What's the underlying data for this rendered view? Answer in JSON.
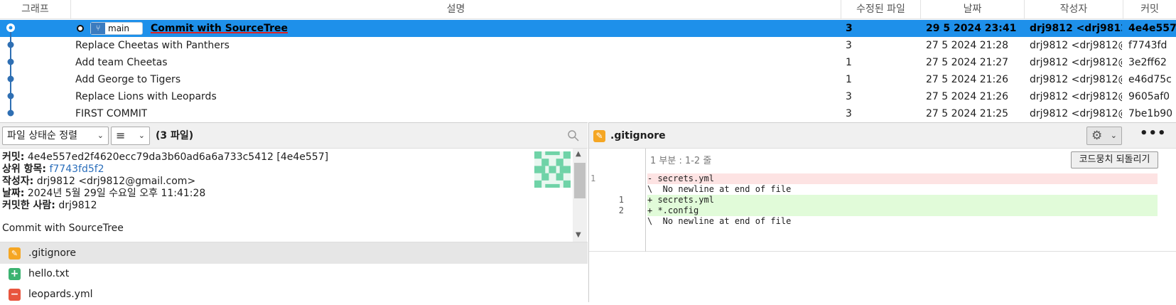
{
  "log": {
    "headers": {
      "graph": "그래프",
      "description": "설명",
      "changed_files": "수정된 파일",
      "date": "날짜",
      "author": "작성자",
      "commit": "커밋"
    },
    "branch_label": "main",
    "commits": [
      {
        "message": "Commit with SourceTree",
        "files": "3",
        "date": "29 5 2024 23:41",
        "author": "drj9812 <drj9812",
        "hash": "4e4e557"
      },
      {
        "message": "Replace Cheetas with Panthers",
        "files": "3",
        "date": "27 5 2024 21:28",
        "author": "drj9812 <drj9812@",
        "hash": "f7743fd"
      },
      {
        "message": "Add team Cheetas",
        "files": "1",
        "date": "27 5 2024 21:27",
        "author": "drj9812 <drj9812@",
        "hash": "3e2ff62"
      },
      {
        "message": "Add George to Tigers",
        "files": "1",
        "date": "27 5 2024 21:26",
        "author": "drj9812 <drj9812@",
        "hash": "e46d75c"
      },
      {
        "message": "Replace Lions with Leopards",
        "files": "3",
        "date": "27 5 2024 21:26",
        "author": "drj9812 <drj9812@",
        "hash": "9605af0"
      },
      {
        "message": "FIRST COMMIT",
        "files": "3",
        "date": "27 5 2024 21:25",
        "author": "drj9812 <drj9812@",
        "hash": "7be1b90"
      }
    ]
  },
  "files_panel": {
    "sort_label": "파일 상태순 정렬",
    "list_icon": "list-icon",
    "file_count": "(3 파일)",
    "search_icon": "search-icon"
  },
  "details": {
    "commit_label": "커밋:",
    "commit_value": "4e4e557ed2f4620ecc79da3b60ad6a6a733c5412 [4e4e557]",
    "parent_label": "상위 항목:",
    "parent_value": "f7743fd5f2",
    "author_label": "작성자:",
    "author_value": "drj9812 <drj9812@gmail.com>",
    "date_label": "날짜:",
    "date_value": "2024년 5월 29일 수요일 오후 11:41:28",
    "committer_label": "커밋한 사람:",
    "committer_value": "drj9812",
    "message": "Commit with SourceTree"
  },
  "changed_files": [
    {
      "name": ".gitignore",
      "status": "modified",
      "color": "#f5a623"
    },
    {
      "name": "hello.txt",
      "status": "added",
      "color": "#3cb371"
    },
    {
      "name": "leopards.yml",
      "status": "removed",
      "color": "#e8553e"
    }
  ],
  "diff": {
    "file_name": ".gitignore",
    "hunk_header": "1 부분 : 1-2 줄",
    "revert_label": "코드뭉치 되돌리기",
    "lines": [
      {
        "type": "rem",
        "old": "1",
        "new": "",
        "text": "- secrets.yml"
      },
      {
        "type": "ctx",
        "old": "",
        "new": "",
        "text": "\\  No newline at end of file"
      },
      {
        "type": "add",
        "old": "",
        "new": "1",
        "text": "+ secrets.yml"
      },
      {
        "type": "add",
        "old": "",
        "new": "2",
        "text": "+ *.config"
      },
      {
        "type": "ctx",
        "old": "",
        "new": "",
        "text": "\\  No newline at end of file"
      }
    ]
  },
  "colors": {
    "selection": "#1e90ea",
    "graph_line": "#2f6fb3",
    "added": "#3cb371",
    "removed": "#e8553e",
    "modified": "#f5a623"
  }
}
